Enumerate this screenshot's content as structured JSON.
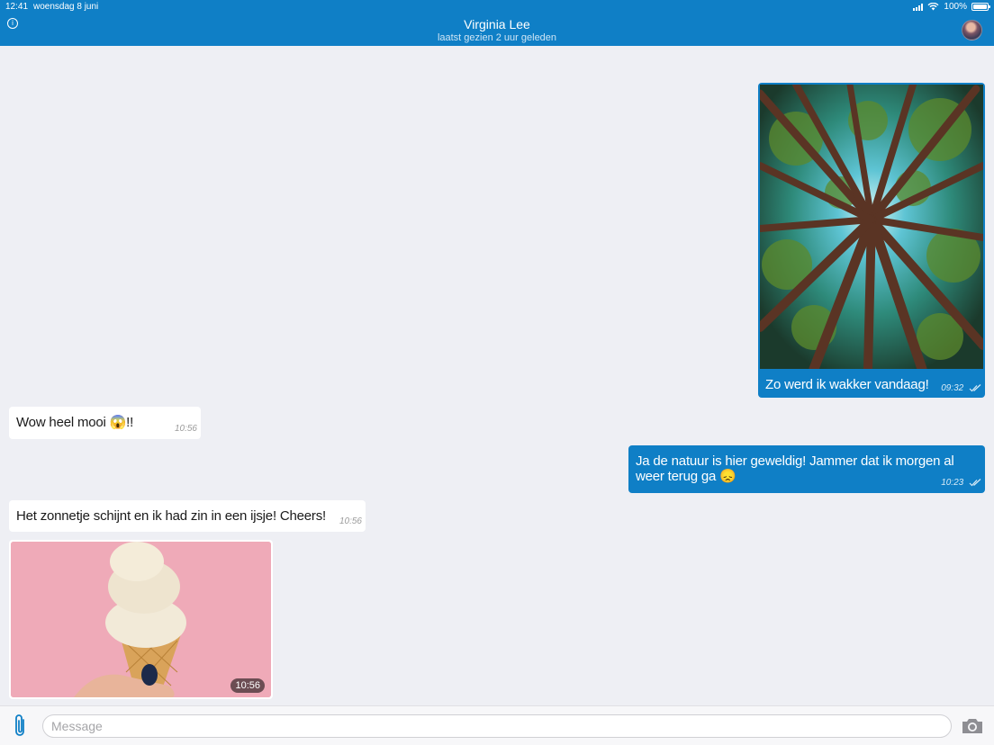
{
  "status_bar": {
    "time": "12:41",
    "date": "woensdag 8 juni",
    "battery": "100%",
    "battery_level": 1.0
  },
  "header": {
    "info_icon": "info-icon",
    "contact_name": "Virginia Lee",
    "contact_status": "laatst gezien 2 uur geleden",
    "avatar": "contact-avatar"
  },
  "colors": {
    "header_bg": "#0f7fc6",
    "outgoing_bubble": "#0f7fc6",
    "incoming_bubble": "#ffffff",
    "chat_bg": "#eeeff4"
  },
  "messages": [
    {
      "direction": "outgoing",
      "type": "image",
      "image": "forest-canopy-photo",
      "text": "Zo werd ik wakker vandaag!",
      "time": "09:32",
      "read": true
    },
    {
      "direction": "incoming",
      "type": "text",
      "text": "Wow heel mooi 😱!!",
      "time": "10:56"
    },
    {
      "direction": "outgoing",
      "type": "text",
      "text": "Ja de natuur is hier geweldig! Jammer dat ik morgen al weer terug ga 😞",
      "time": "10:23",
      "read": true
    },
    {
      "direction": "incoming",
      "type": "text",
      "text": "Het zonnetje schijnt en ik had zin in een ijsje! Cheers!",
      "time": "10:56"
    },
    {
      "direction": "incoming",
      "type": "image",
      "image": "ice-cream-cone-photo",
      "time": "10:56"
    }
  ],
  "composer": {
    "attach_icon": "paperclip-icon",
    "placeholder": "Message",
    "value": "",
    "camera_icon": "camera-icon"
  }
}
